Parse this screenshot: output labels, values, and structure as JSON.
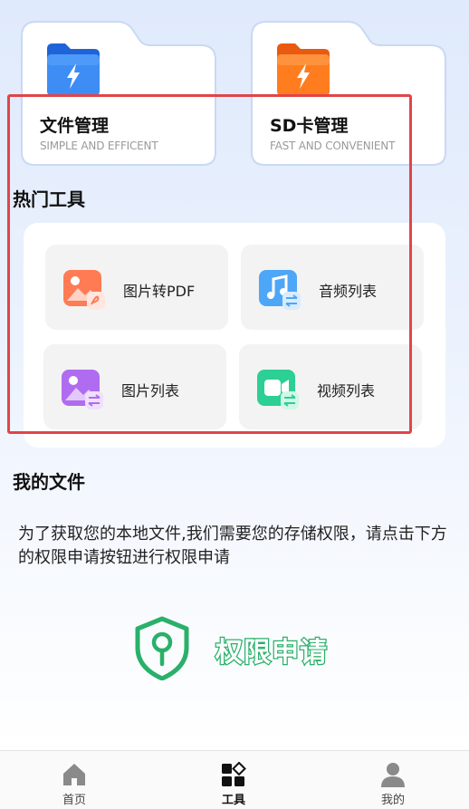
{
  "folders": [
    {
      "title": "文件管理",
      "subtitle": "SIMPLE AND EFFICENT",
      "icon": "blue-folder-icon",
      "color": "#2f7ff2"
    },
    {
      "title": "SD卡管理",
      "subtitle": "FAST AND CONVENIENT",
      "icon": "orange-folder-icon",
      "color": "#ff7a1a"
    }
  ],
  "hot_tools": {
    "title": "热门工具",
    "items": [
      {
        "label": "图片转PDF",
        "icon": "image-to-pdf-icon",
        "color": "#ff7b54"
      },
      {
        "label": "音频列表",
        "icon": "music-icon",
        "color": "#4ea6f7"
      },
      {
        "label": "图片列表",
        "icon": "image-list-icon",
        "color": "#b06cf0"
      },
      {
        "label": "视频列表",
        "icon": "video-icon",
        "color": "#2ccf94"
      }
    ]
  },
  "my_files": {
    "title": "我的文件",
    "description": "为了获取您的本地文件,我们需要您的存储权限，请点击下方的权限申请按钮进行权限申请",
    "permission_button": "权限申请",
    "permission_icon": "shield-key-icon",
    "accent": "#2ab06a"
  },
  "bottom_nav": [
    {
      "label": "首页",
      "icon": "home-icon",
      "active": false
    },
    {
      "label": "工具",
      "icon": "tools-grid-icon",
      "active": true
    },
    {
      "label": "我的",
      "icon": "user-icon",
      "active": false
    }
  ]
}
